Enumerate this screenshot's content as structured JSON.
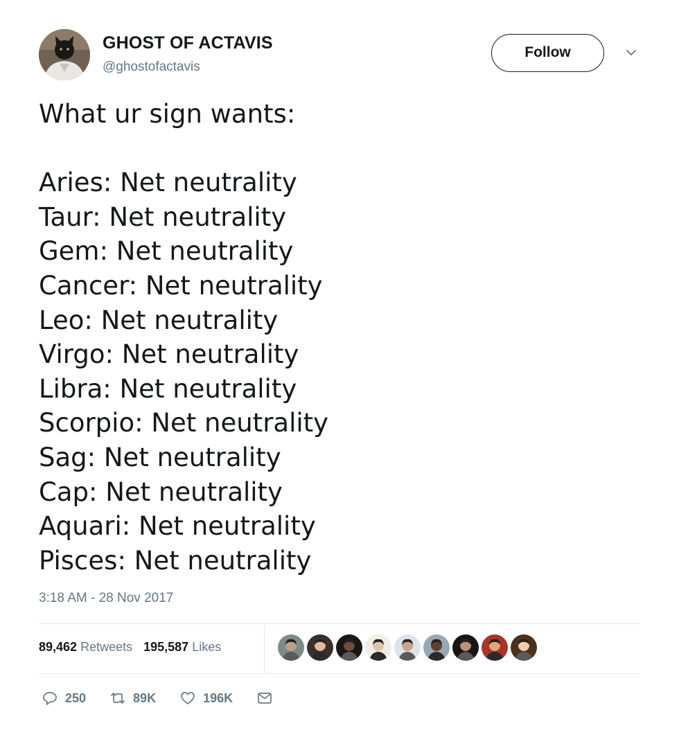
{
  "author": {
    "display_name": "GHOST OF ACTAVIS",
    "handle": "@ghostofactavis"
  },
  "header": {
    "follow_label": "Follow"
  },
  "tweet": {
    "lines": [
      "What ur sign wants:",
      "",
      "Aries: Net neutrality",
      "Taur: Net neutrality",
      "Gem: Net neutrality",
      "Cancer: Net neutrality",
      "Leo: Net neutrality",
      "Virgo: Net neutrality",
      "Libra: Net neutrality",
      "Scorpio: Net neutrality",
      "Sag: Net neutrality",
      "Cap: Net neutrality",
      "Aquari: Net neutrality",
      "Pisces: Net neutrality"
    ],
    "timestamp": "3:18 AM - 28 Nov 2017"
  },
  "stats": {
    "retweets_count": "89,462",
    "retweets_label": "Retweets",
    "likes_count": "195,587",
    "likes_label": "Likes"
  },
  "likers": [
    {
      "skin": "#b9a38f",
      "bg": "#7d8a8a"
    },
    {
      "skin": "#e2b8a2",
      "bg": "#3a2f2a"
    },
    {
      "skin": "#6a5040",
      "bg": "#1a1614"
    },
    {
      "skin": "#d9c6b2",
      "bg": "#f1ece4"
    },
    {
      "skin": "#c8a48a",
      "bg": "#dce3ea"
    },
    {
      "skin": "#5e4130",
      "bg": "#9aa8b6"
    },
    {
      "skin": "#b6937c",
      "bg": "#161616"
    },
    {
      "skin": "#e0a67a",
      "bg": "#a8342a"
    },
    {
      "skin": "#f0cdb0",
      "bg": "#4a3220"
    }
  ],
  "actions": {
    "reply_count": "250",
    "retweet_count": "89K",
    "like_count": "196K"
  },
  "icons": {
    "reply": "reply-icon",
    "retweet": "retweet-icon",
    "like": "heart-icon",
    "dm": "envelope-icon",
    "menu": "chevron-down-icon"
  },
  "colors": {
    "text": "#14171a",
    "muted": "#657786",
    "divider": "#e6ecf0"
  }
}
